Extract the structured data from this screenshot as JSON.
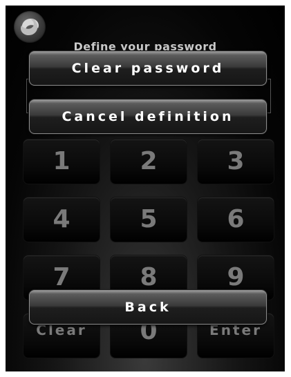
{
  "title": "Define your password",
  "buttons": {
    "clear_password": "Clear password",
    "cancel_definition": "Cancel definition",
    "back": "Back"
  },
  "keypad": {
    "keys": [
      "1",
      "2",
      "3",
      "4",
      "5",
      "6",
      "7",
      "8",
      "9",
      "Clear",
      "0",
      "Enter"
    ]
  },
  "icons": {
    "logo": "app-logo-icon"
  },
  "colors": {
    "background": "#000000",
    "button_text": "#ffffff",
    "key_text": "#7a7a7a"
  }
}
